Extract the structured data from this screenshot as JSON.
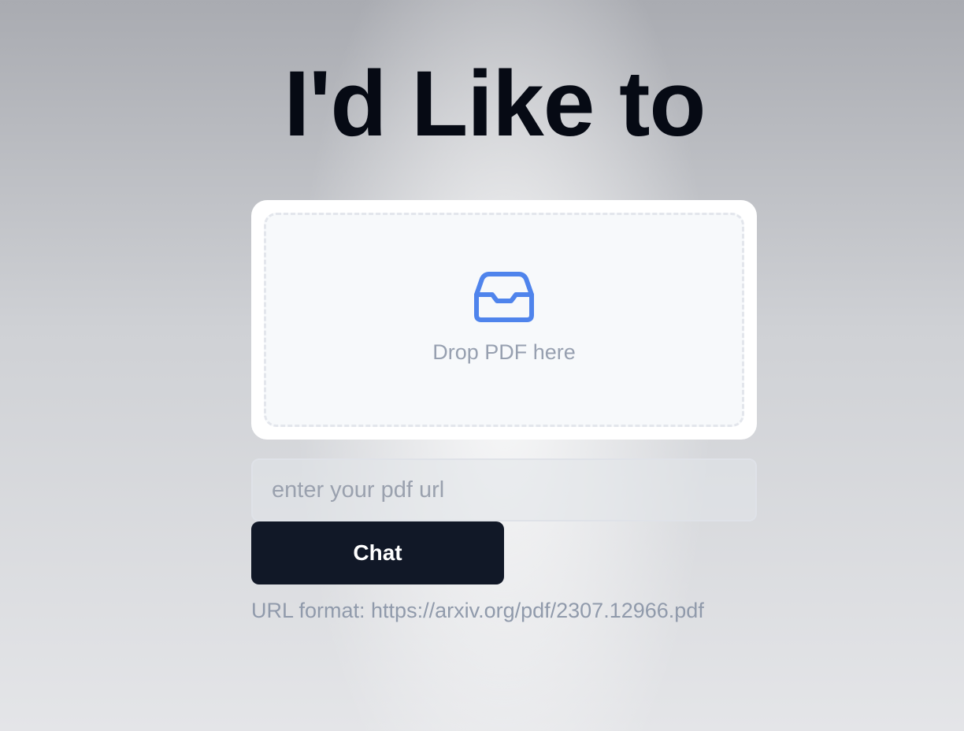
{
  "header": {
    "title": "I'd Like to"
  },
  "upload": {
    "icon": "inbox-icon",
    "icon_color": "#4f84ec",
    "drop_label": "Drop PDF here"
  },
  "url_form": {
    "placeholder": "enter your pdf url",
    "value": "",
    "submit_label": "Chat",
    "hint": "URL format: https://arxiv.org/pdf/2307.12966.pdf"
  },
  "colors": {
    "button_bg": "#111827",
    "title": "#060a14"
  }
}
